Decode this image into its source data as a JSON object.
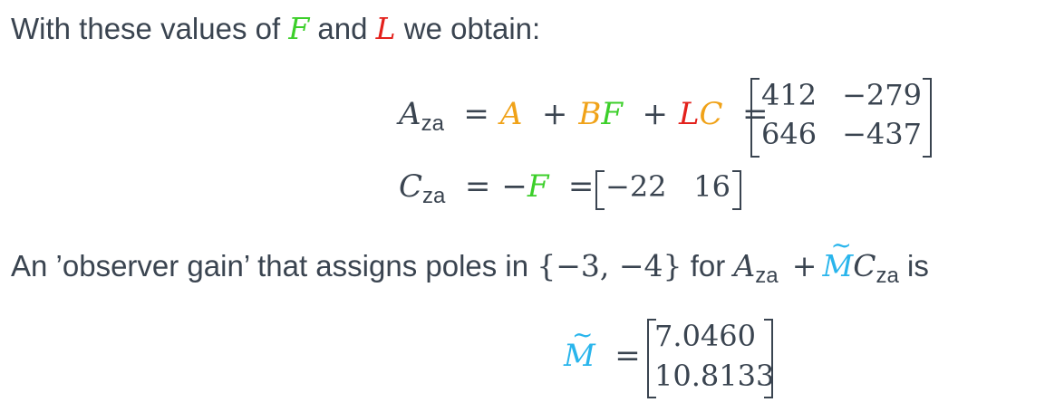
{
  "intro": {
    "prefix": "With these values of",
    "F": "F",
    "and": "and",
    "L": "L",
    "suffix": "we obtain:"
  },
  "eq1": {
    "lhs": "A",
    "lhs_sub": "za",
    "rhs_A": "A",
    "plus1": "+",
    "rhs_BF_B": "B",
    "rhs_BF_F": "F",
    "plus2": "+",
    "rhs_LC_L": "L",
    "rhs_LC_C": "C",
    "eq": "=",
    "eq2": "=",
    "matrix": [
      [
        "412",
        "−279"
      ],
      [
        "646",
        "−437"
      ]
    ]
  },
  "eq2": {
    "lhs": "C",
    "lhs_sub": "za",
    "eq": "=",
    "neg": "−",
    "F": "F",
    "eq2": "=",
    "matrix": [
      "−22",
      "16"
    ]
  },
  "observer": {
    "prefix": "An ’observer gain’ that assigns poles in",
    "set": "{−3, −4}",
    "for": "for",
    "A": "A",
    "A_sub": "za",
    "plus": "+",
    "M": "M",
    "C": "C",
    "C_sub": "za",
    "is": "is"
  },
  "eq3": {
    "lhs": "M",
    "eq": "=",
    "matrix": [
      "7.0460",
      "10.8133"
    ]
  },
  "colors": {
    "text": "#3a4450",
    "green": "#3ccf2a",
    "red": "#e3211c",
    "orange": "#f0a218",
    "blue": "#29b5ec"
  }
}
